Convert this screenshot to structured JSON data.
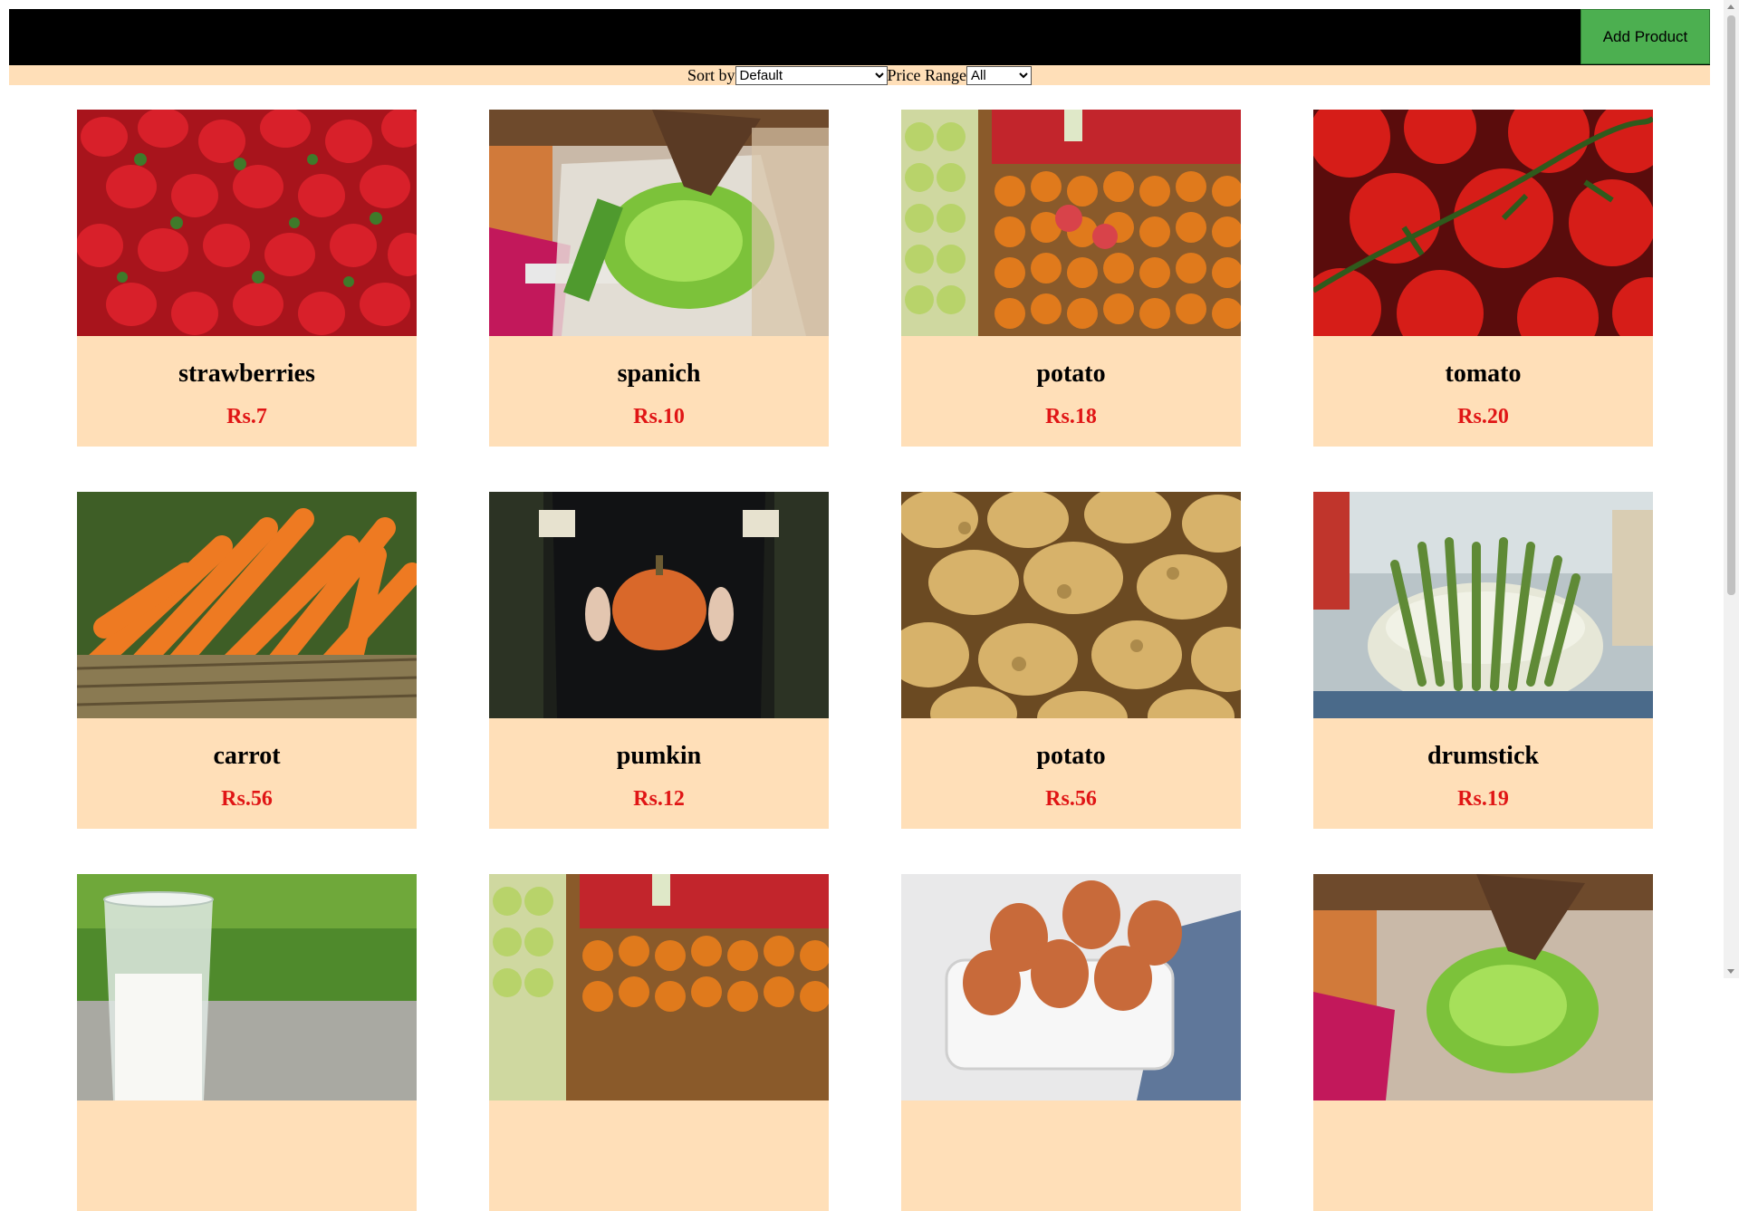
{
  "header": {
    "add_product_label": "Add Product"
  },
  "filters": {
    "sort_label": "Sort by",
    "sort_value": "Default",
    "price_label": "Price Range",
    "price_value": "All"
  },
  "products": [
    {
      "name": "strawberries",
      "price": "Rs.7",
      "image": "strawberries"
    },
    {
      "name": "spanich",
      "price": "Rs.10",
      "image": "lettuce"
    },
    {
      "name": "potato",
      "price": "Rs.18",
      "image": "fruit-stall"
    },
    {
      "name": "tomato",
      "price": "Rs.20",
      "image": "tomatoes"
    },
    {
      "name": "carrot",
      "price": "Rs.56",
      "image": "carrots"
    },
    {
      "name": "pumkin",
      "price": "Rs.12",
      "image": "pumpkin"
    },
    {
      "name": "potato",
      "price": "Rs.56",
      "image": "potatoes"
    },
    {
      "name": "drumstick",
      "price": "Rs.19",
      "image": "asparagus"
    },
    {
      "name": "",
      "price": "",
      "image": "milk"
    },
    {
      "name": "",
      "price": "",
      "image": "fruit-stall"
    },
    {
      "name": "",
      "price": "",
      "image": "eggs"
    },
    {
      "name": "",
      "price": "",
      "image": "lettuce"
    }
  ]
}
